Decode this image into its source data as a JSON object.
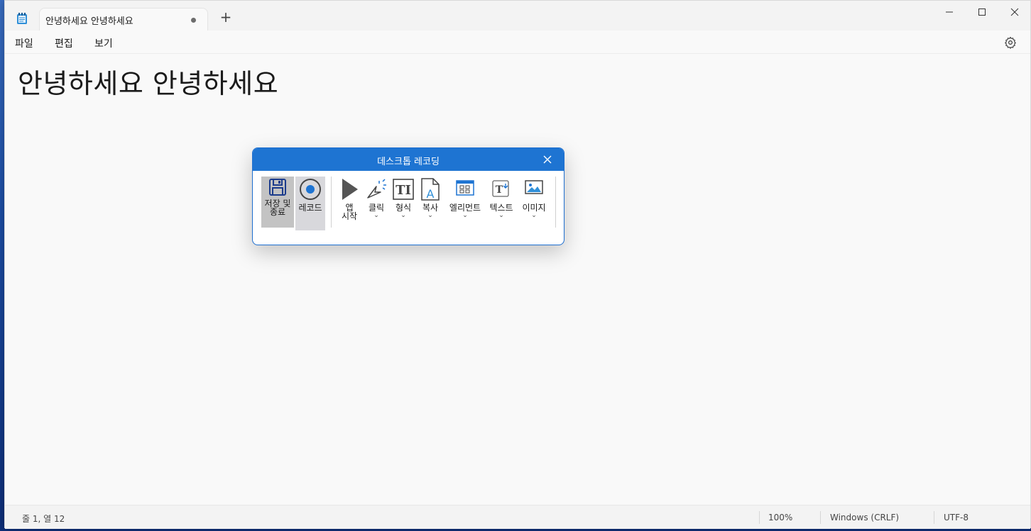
{
  "window": {
    "tab_title": "안녕하세요 안녕하세요",
    "new_tab_label": "+"
  },
  "menu": {
    "file": "파일",
    "edit": "편집",
    "view": "보기"
  },
  "editor": {
    "content": "안녕하세요 안녕하세요"
  },
  "status": {
    "position": "줄 1, 열 12",
    "zoom": "100%",
    "line_ending": "Windows (CRLF)",
    "encoding": "UTF-8"
  },
  "recorder": {
    "title": "데스크톱 레코딩",
    "tools": {
      "save_line1": "저장 및",
      "save_line2": "종료",
      "record": "레코드",
      "app_start_line1": "앱",
      "app_start_line2": "시작",
      "click": "클릭",
      "type": "형식",
      "copy": "복사",
      "element": "엘리먼트",
      "text": "텍스트",
      "image": "이미지"
    },
    "chevron": "⌄"
  },
  "colors": {
    "accent": "#1e74d2",
    "editor_bg": "#f9f9f9",
    "titlebar_bg": "#f3f3f3"
  }
}
